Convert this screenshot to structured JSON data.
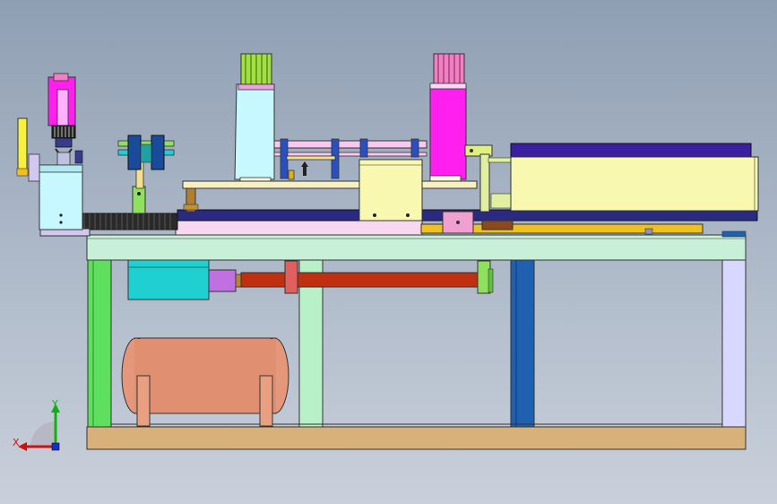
{
  "viewport": {
    "background_top": "#8f9fb3",
    "background_bottom": "#c9d0db"
  },
  "triad": {
    "x_label": "X",
    "y_label": "Y",
    "x_color": "#d01010",
    "y_color": "#10b010",
    "z_color": "#1030d0"
  },
  "colors": {
    "frame_green": "#5ee05e",
    "frame_mint": "#b8f0c8",
    "base_wood": "#d8b07a",
    "tank_copper": "#e09070",
    "magenta": "#ff20f0",
    "cyan_panel": "#c8f8ff",
    "cream_box": "#f8f8b0",
    "navy": "#2a2a80",
    "blue_post": "#2060b0",
    "lavender": "#d8d8ff",
    "teal_motor": "#20d0d0",
    "rod_red": "#c03010",
    "orange_bar": "#f0c020"
  }
}
